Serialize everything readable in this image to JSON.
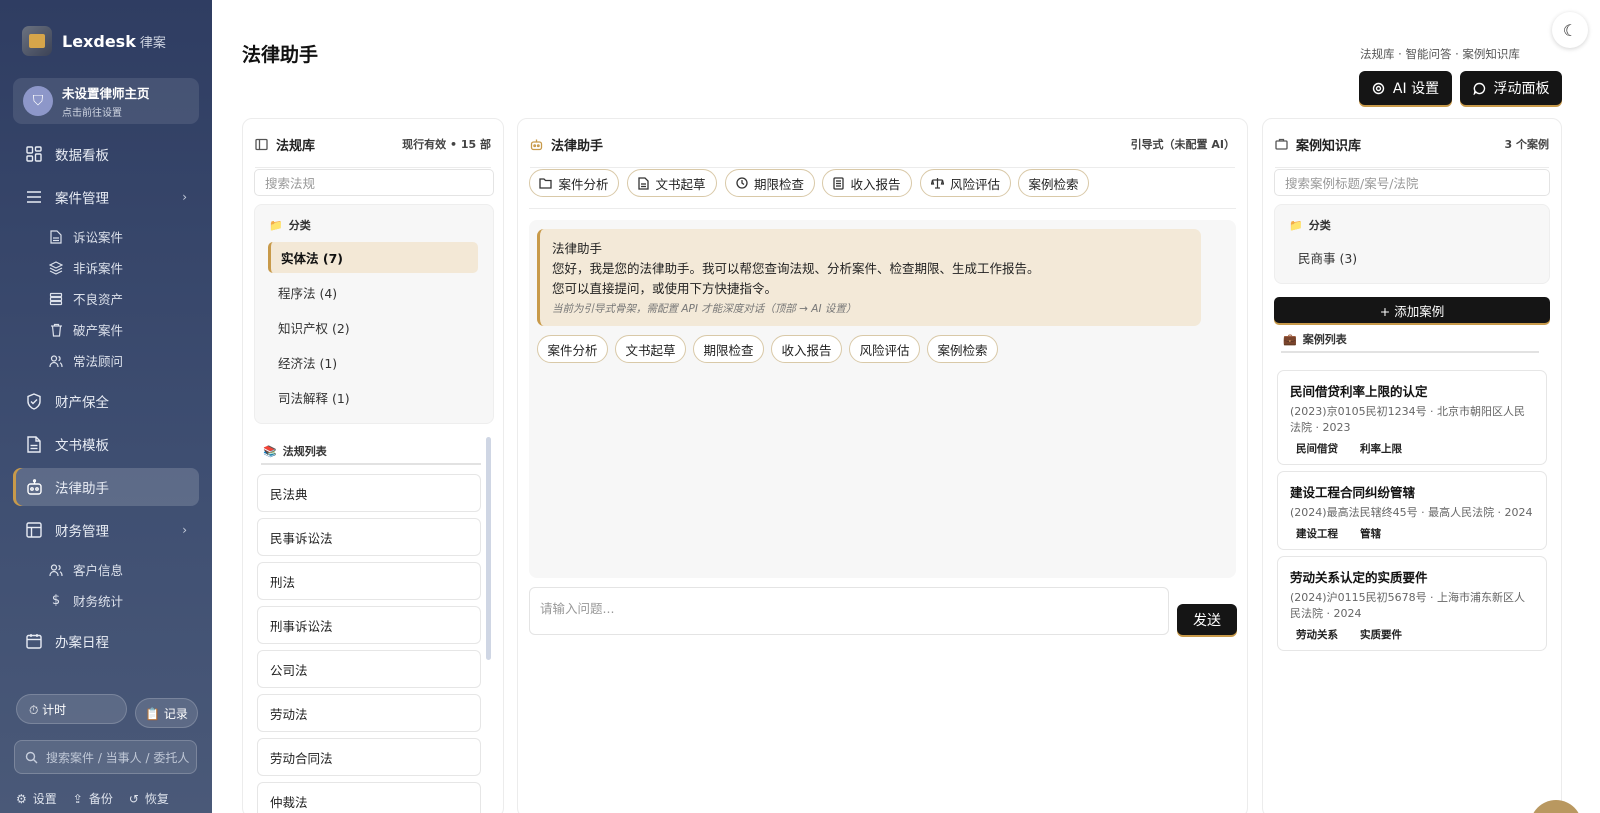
{
  "sidebar": {
    "brand_name": "Lexdesk",
    "brand_sub": "律案",
    "profile_name": "未设置律师主页",
    "profile_hint": "点击前往设置",
    "avatar_glyph": "⛉",
    "items": [
      {
        "label": "数据看板",
        "icon": "dashboard-icon"
      },
      {
        "label": "案件管理",
        "icon": "menu-icon"
      },
      {
        "label": "财产保全",
        "icon": "shield-icon"
      },
      {
        "label": "文书模板",
        "icon": "document-icon"
      },
      {
        "label": "法律助手",
        "icon": "robot-icon"
      },
      {
        "label": "财务管理",
        "icon": "finance-icon"
      },
      {
        "label": "办案日程",
        "icon": "calendar-icon"
      }
    ],
    "case_sub": [
      "诉讼案件",
      "非诉案件",
      "不良资产",
      "破产案件",
      "常法顾问"
    ],
    "finance_sub": [
      "客户信息",
      "财务统计"
    ],
    "timer_label": "⏱ 计时",
    "record_label": "📋 记录",
    "search_placeholder": "搜索案件 / 当事人 / 委托人",
    "footer": {
      "settings": "设置",
      "backup": "备份",
      "restore": "恢复"
    }
  },
  "header": {
    "title": "法律助手",
    "meta": "法规库 · 智能问答 · 案例知识库",
    "ai_settings": "AI 设置",
    "float_panel": "浮动面板"
  },
  "law_panel": {
    "title": "法规库",
    "status": "现行有效 • 15 部",
    "search_placeholder": "搜索法规",
    "category_title": "分类",
    "categories": [
      "实体法 (7)",
      "程序法 (4)",
      "知识产权 (2)",
      "经济法 (1)",
      "司法解释 (1)"
    ],
    "list_title": "法规列表",
    "laws": [
      "民法典",
      "民事诉讼法",
      "刑法",
      "刑事诉讼法",
      "公司法",
      "劳动法",
      "劳动合同法",
      "仲裁法"
    ]
  },
  "assistant_panel": {
    "title": "法律助手",
    "mode": "引导式（未配置 AI）",
    "quick_chips": [
      "案件分析",
      "文书起草",
      "期限检查",
      "收入报告",
      "风险评估",
      "案例检索"
    ],
    "bubble_title": "法律助手",
    "bubble_line1": "您好，我是您的法律助手。我可以帮您查询法规、分析案件、检查期限、生成工作报告。",
    "bubble_line2": "您可以直接提问，或使用下方快捷指令。",
    "bubble_note": "当前为引导式骨架，需配置 API 才能深度对话（顶部 → AI 设置）",
    "reply_chips": [
      "案件分析",
      "文书起草",
      "期限检查",
      "收入报告",
      "风险评估",
      "案例检索"
    ],
    "input_placeholder": "请输入问题...",
    "send_label": "发送"
  },
  "case_panel": {
    "title": "案例知识库",
    "count": "3 个案例",
    "search_placeholder": "搜索案例标题/案号/法院",
    "category_title": "分类",
    "categories": [
      "民商事 (3)"
    ],
    "add_label": "+ 添加案例",
    "list_title": "案例列表",
    "cases": [
      {
        "title": "民间借贷利率上限的认定",
        "meta": "(2023)京0105民初1234号 · 北京市朝阳区人民法院 · 2023",
        "tags": [
          "民间借贷",
          "利率上限"
        ]
      },
      {
        "title": "建设工程合同纠纷管辖",
        "meta": "(2024)最高法民辖终45号 · 最高人民法院 · 2024",
        "tags": [
          "建设工程",
          "管辖"
        ]
      },
      {
        "title": "劳动关系认定的实质要件",
        "meta": "(2024)沪0115民初5678号 · 上海市浦东新区人民法院 · 2024",
        "tags": [
          "劳动关系",
          "实质要件"
        ]
      }
    ]
  },
  "colors": {
    "accent": "#c89a4a",
    "sidebar": "#34426a",
    "dark_button": "#151515"
  }
}
